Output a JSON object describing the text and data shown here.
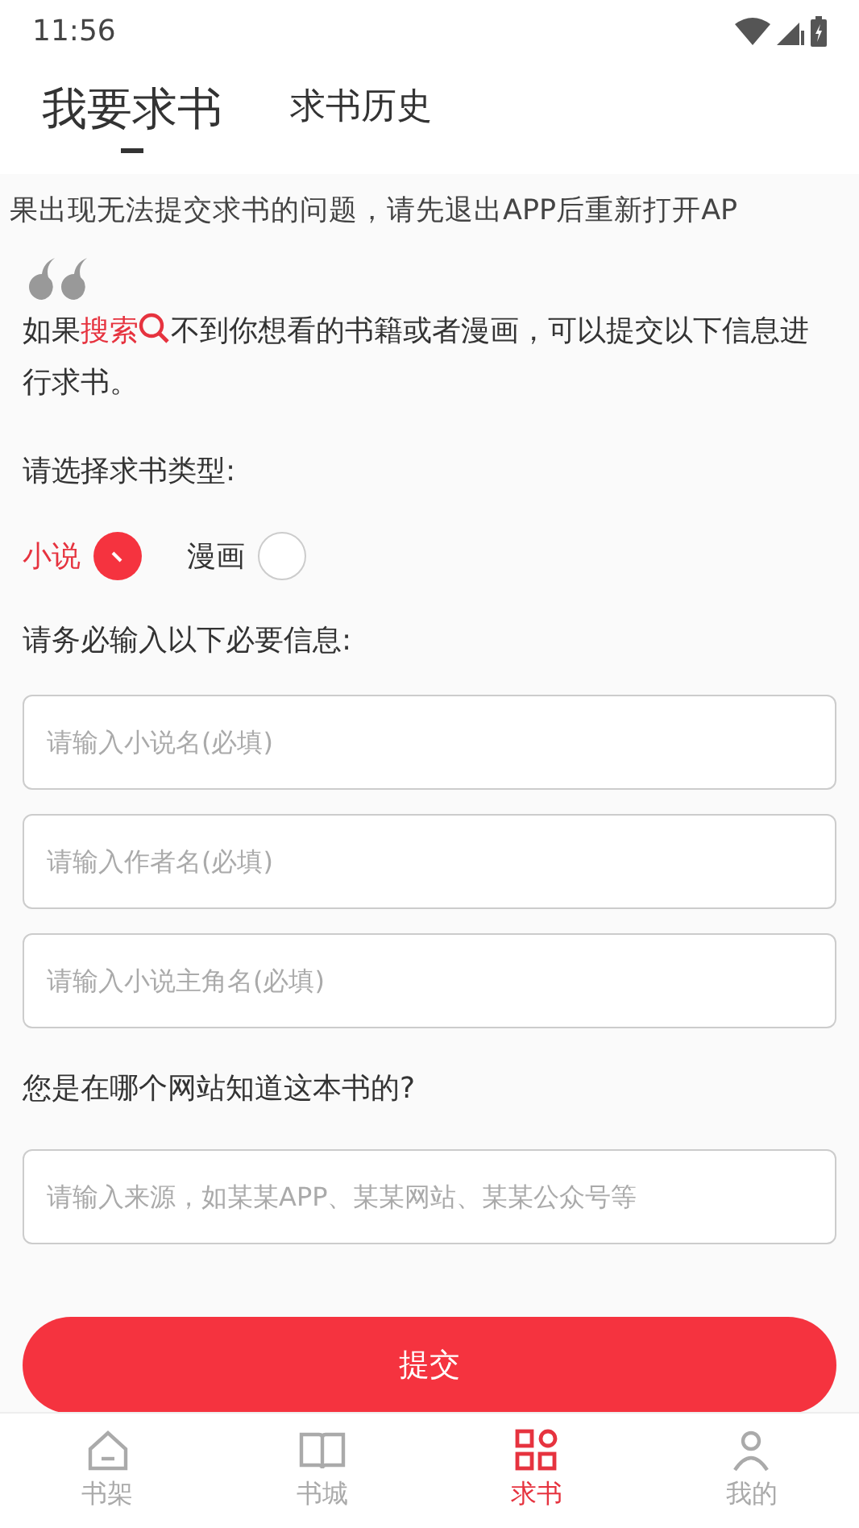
{
  "status_bar": {
    "time": "11:56"
  },
  "tabs": [
    {
      "label": "我要求书",
      "selected": true
    },
    {
      "label": "求书历史",
      "selected": false
    }
  ],
  "notice": "果出现无法提交求书的问题，请先退出APP后重新打开AP",
  "intro": "如果**搜索**不到你想看的书籍或者漫画，可以提交以下信息进行求书。",
  "type_prompt": "请选择求书类型:",
  "types": [
    {
      "label": "小说",
      "selected": true
    },
    {
      "label": "漫画",
      "selected": false
    }
  ],
  "required_prompt": "请务必输入以下必要信息:",
  "fields": [
    {
      "placeholder": "请输入小说名(必填)"
    },
    {
      "placeholder": "请输入作者名(必填)"
    },
    {
      "placeholder": "请输入小说主角名(必填)"
    }
  ],
  "source_prompt": "您是在哪个网站知道这本书的?",
  "source_field": {
    "placeholder": "请输入来源，如某某APP、某某网站、某某公众号等"
  },
  "submit": "提交",
  "bottom_nav": [
    {
      "label": "书架",
      "kind": "home",
      "selected": false
    },
    {
      "label": "书城",
      "kind": "book",
      "selected": false
    },
    {
      "label": "求书",
      "kind": "grid",
      "selected": true
    },
    {
      "label": "我的",
      "kind": "person",
      "selected": false
    }
  ]
}
